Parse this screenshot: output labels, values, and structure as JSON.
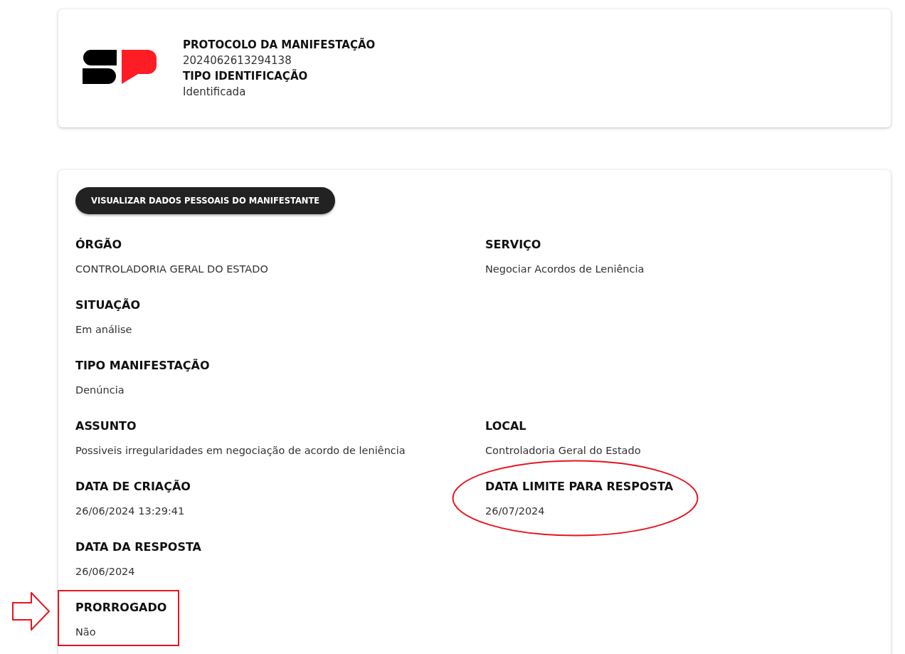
{
  "header": {
    "fields": [
      {
        "label": "PROTOCOLO DA MANIFESTAÇÃO",
        "value": "2024062613294138"
      },
      {
        "label": "TIPO IDENTIFICAÇÃO",
        "value": "Identificada"
      }
    ]
  },
  "button": {
    "label": "VISUALIZAR DADOS PESSOAIS DO MANIFESTANTE"
  },
  "rows": [
    [
      {
        "label": "ÓRGÃO",
        "value": "CONTROLADORIA GERAL DO ESTADO",
        "circled": false,
        "boxed": false
      },
      {
        "label": "SERVIÇO",
        "value": "Negociar Acordos de Leniência",
        "circled": false,
        "boxed": false
      }
    ],
    [
      {
        "label": "SITUAÇÃO",
        "value": "Em análise",
        "circled": false,
        "boxed": false
      }
    ],
    [
      {
        "label": "TIPO MANIFESTAÇÃO",
        "value": "Denúncia",
        "circled": false,
        "boxed": false
      }
    ],
    [
      {
        "label": "ASSUNTO",
        "value": "Possiveis irregularidades em negociação de acordo de leniência",
        "circled": false,
        "boxed": false
      },
      {
        "label": "LOCAL",
        "value": "Controladoria Geral do Estado",
        "circled": false,
        "boxed": false
      }
    ],
    [
      {
        "label": "DATA DE CRIAÇÃO",
        "value": "26/06/2024 13:29:41",
        "circled": false,
        "boxed": false
      },
      {
        "label": "DATA LIMITE PARA RESPOSTA",
        "value": "26/07/2024",
        "circled": true,
        "boxed": false
      }
    ],
    [
      {
        "label": "DATA DA RESPOSTA",
        "value": "26/06/2024",
        "circled": false,
        "boxed": false
      }
    ],
    [
      {
        "label": "PRORROGADO",
        "value": "Não",
        "circled": false,
        "boxed": true
      }
    ]
  ]
}
